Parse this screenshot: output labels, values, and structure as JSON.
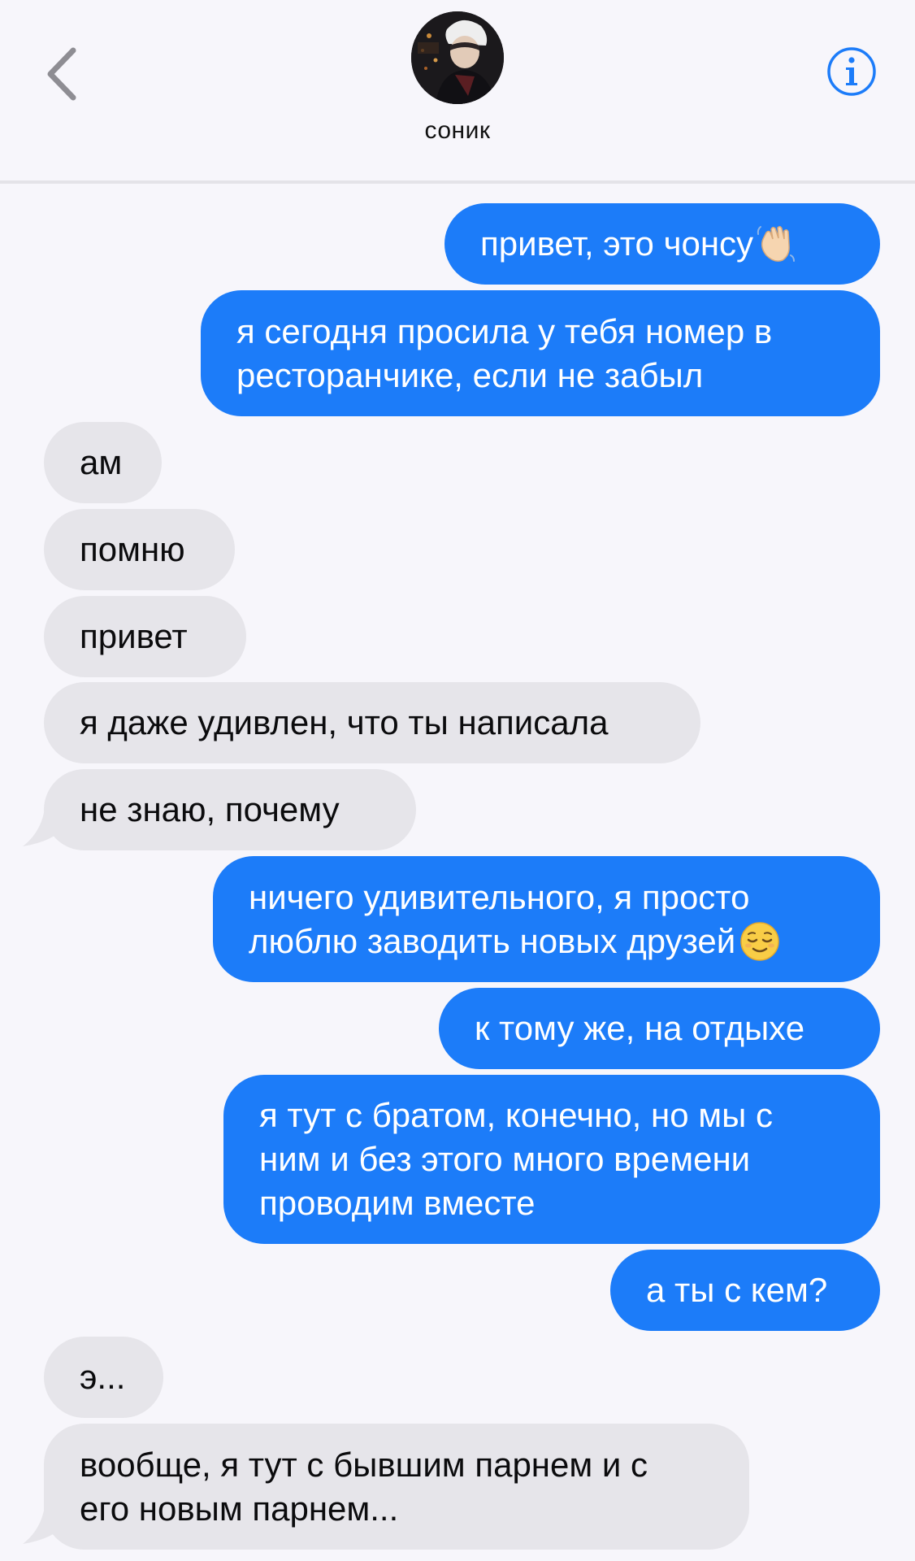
{
  "header": {
    "contact_name": "соник",
    "back_icon": "chevron-left-icon",
    "info_icon": "info-icon",
    "accent_color": "#1c7cf9"
  },
  "messages": [
    {
      "direction": "sent",
      "lines": [
        "привет, это чонсу"
      ],
      "emoji": "waving-hand"
    },
    {
      "direction": "sent",
      "lines": [
        "я сегодня просила у тебя номер в",
        "ресторанчике, если не забыл"
      ]
    },
    {
      "direction": "received",
      "lines": [
        "ам"
      ]
    },
    {
      "direction": "received",
      "lines": [
        "помню"
      ]
    },
    {
      "direction": "received",
      "lines": [
        "привет"
      ]
    },
    {
      "direction": "received",
      "lines": [
        "я даже удивлен, что ты написала"
      ]
    },
    {
      "direction": "received",
      "lines": [
        "не знаю, почему"
      ]
    },
    {
      "direction": "sent",
      "lines": [
        "ничего удивительного, я просто",
        "люблю заводить новых друзей"
      ],
      "emoji": "relieved-face"
    },
    {
      "direction": "sent",
      "lines": [
        "к тому же, на отдыхе"
      ]
    },
    {
      "direction": "sent",
      "lines": [
        "я тут с братом, конечно, но мы с",
        "ним и без этого много времени",
        "проводим вместе"
      ]
    },
    {
      "direction": "sent",
      "lines": [
        "а ты с кем?"
      ]
    },
    {
      "direction": "received",
      "lines": [
        "э..."
      ]
    },
    {
      "direction": "received",
      "lines": [
        "вообще, я тут с бывшим парнем и с",
        "его новым парнем..."
      ]
    }
  ]
}
